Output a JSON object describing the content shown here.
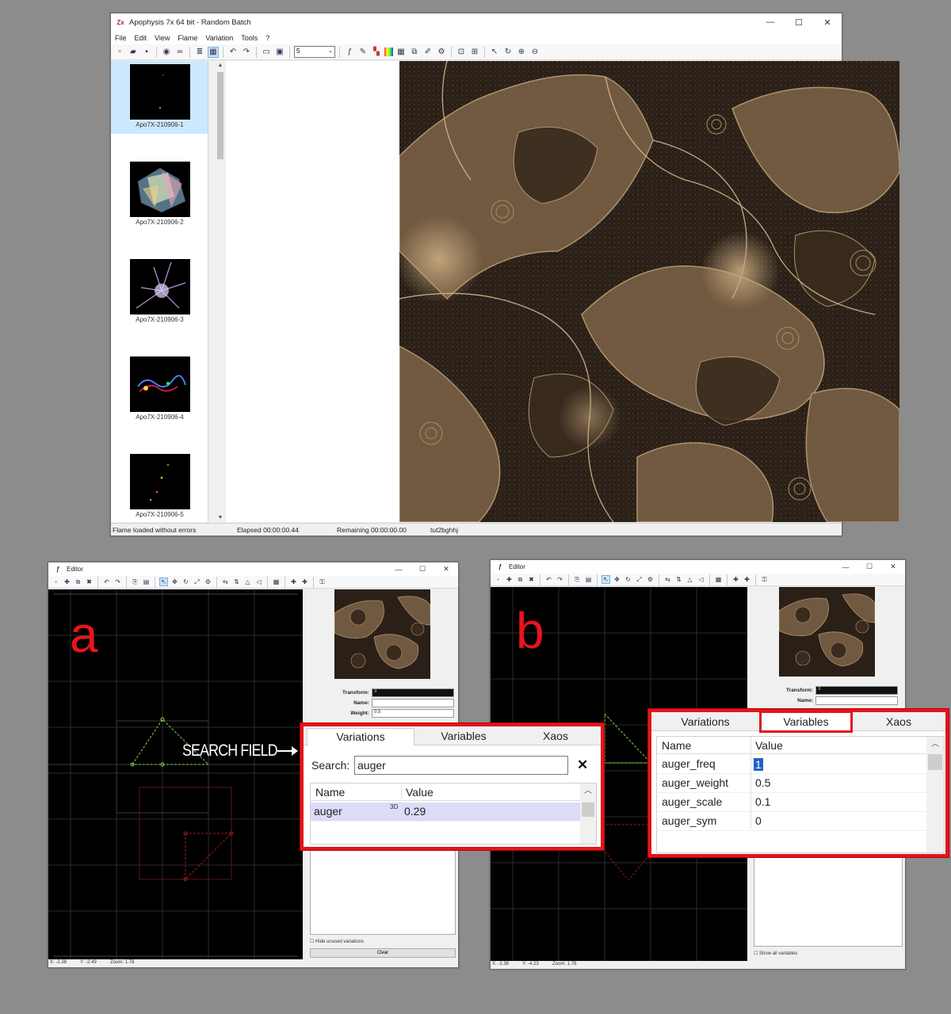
{
  "main_window": {
    "title": "Apophysis 7x 64 bit - Random Batch",
    "app_icon": "Zx",
    "menu": [
      "File",
      "Edit",
      "View",
      "Flame",
      "Variation",
      "Tools",
      "?"
    ],
    "toolbar_combo_value": "5",
    "thumbnails": [
      {
        "label": "Apo7X-210906-1",
        "selected": true
      },
      {
        "label": "Apo7X-210906-2",
        "selected": false
      },
      {
        "label": "Apo7X-210906-3",
        "selected": false
      },
      {
        "label": "Apo7X-210906-4",
        "selected": false
      },
      {
        "label": "Apo7X-210906-5",
        "selected": false
      }
    ],
    "status": {
      "message": "Flame loaded without errors",
      "elapsed": "Elapsed 00:00:00.44",
      "remaining": "Remaining 00:00:00.00",
      "name": "tut2bghhj"
    }
  },
  "editor_a": {
    "title": "Editor",
    "letter": "a",
    "transform_label": "Transform:",
    "transform_value": "3",
    "name_label": "Name:",
    "weight_label": "Weight:",
    "weight_value": "0.5",
    "hide_unused": "Hide unused variations",
    "clear_button": "Clear",
    "status": {
      "x": "X: -2.38",
      "y": "Y: -2.49",
      "zoom": "Zoom: 1.78"
    }
  },
  "editor_b": {
    "title": "Editor",
    "letter": "b",
    "transform_label": "Transform:",
    "transform_value": "3",
    "name_label": "Name:",
    "show_all": "Show all variables",
    "status": {
      "x": "X: -2.38",
      "y": "Y: -4.23",
      "zoom": "Zoom: 1.78"
    }
  },
  "annotation": {
    "search_field": "SEARCH FIELD"
  },
  "callout_a": {
    "tabs": [
      "Variations",
      "Variables",
      "Xaos"
    ],
    "search_label": "Search:",
    "search_value": "auger",
    "clear_icon": "✕",
    "columns": [
      "Name",
      "Value"
    ],
    "rows": [
      {
        "name": "auger",
        "badge": "3D",
        "value": "0.29"
      }
    ]
  },
  "callout_b": {
    "tabs": [
      "Variations",
      "Variables",
      "Xaos"
    ],
    "columns": [
      "Name",
      "Value"
    ],
    "rows": [
      {
        "name": "auger_freq",
        "value": "1"
      },
      {
        "name": "auger_weight",
        "value": "0.5"
      },
      {
        "name": "auger_scale",
        "value": "0.1"
      },
      {
        "name": "auger_sym",
        "value": "0"
      }
    ]
  },
  "colors": {
    "callout_border": "#e2161d",
    "selection": "#cce8ff",
    "fractal_tone": "#b89a73"
  }
}
